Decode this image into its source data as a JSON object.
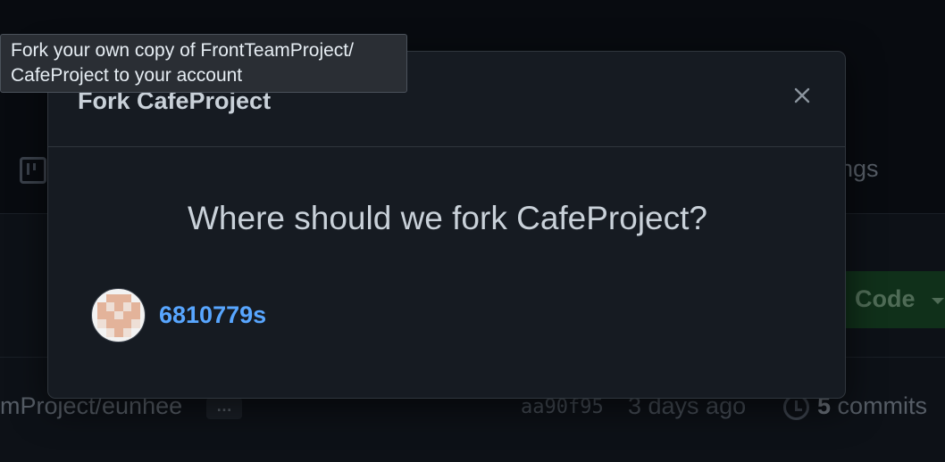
{
  "background": {
    "settings_tab_partial": "ngs",
    "code_button_label": "Code",
    "branch_path_partial": "mProject/eunhee",
    "ellipsis_label": "…",
    "commit_sha": "aa90f95",
    "commit_time": "3 days ago",
    "commits_count": "5",
    "commits_label": "commits"
  },
  "tooltip": {
    "line1": "Fork your own copy of FrontTeamProject/",
    "line2": "CafeProject to your account"
  },
  "modal": {
    "title": "Fork CafeProject",
    "close_icon": "close-icon",
    "question": "Where should we fork CafeProject?",
    "owner": {
      "name": "6810779s",
      "avatar_icon": "identicon-avatar"
    }
  },
  "colors": {
    "link": "#58a6ff",
    "modal_bg": "#161b22",
    "border": "#30363d",
    "avatar_pattern": "#e3b39a",
    "avatar_pattern_light": "#eedfd6"
  }
}
